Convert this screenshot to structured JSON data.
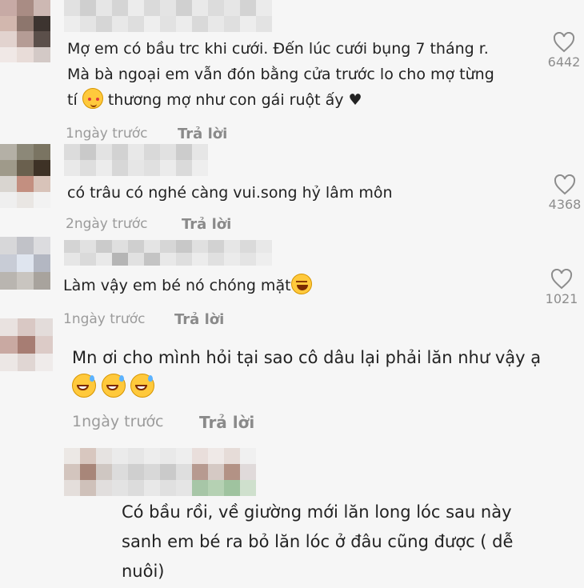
{
  "comments": [
    {
      "lines": [
        "Mợ em có bầu trc khi cưới. Đến lúc cưới bụng 7 tháng r.",
        "Mà bà ngoại em vẫn đón bằng cửa trước lo cho mợ từng",
        "tí"
      ],
      "line3_after_emoji": " thương mợ như con gái ruột ấy ♥",
      "emoji": "smiling-face-with-hearts",
      "time": "1ngày trước",
      "reply": "Trả lời",
      "likes": "6442"
    },
    {
      "lines": [
        "có trâu có nghé càng vui.song hỷ lâm môn"
      ],
      "time": "2ngày trước",
      "reply": "Trả lời",
      "likes": "4368"
    },
    {
      "lines": [
        "Làm vậy em bé nó chóng mặt"
      ],
      "emoji": "rolling-on-floor-laughing",
      "time": "1ngày trước",
      "reply": "Trả lời",
      "likes": "1021"
    },
    {
      "lines": [
        "Mn ơi cho mình hỏi tại sao cô dâu lại phải lăn như vậy ạ"
      ],
      "emoji": "grinning-face-with-sweat",
      "time": "1ngày trước",
      "reply": "Trả lời"
    },
    {
      "lines": [
        "Có bầu rồi, về giường mới lăn long lóc sau này",
        "sanh em bé ra bỏ lăn lóc ở đâu cũng được ( dễ",
        "nuôi)"
      ]
    }
  ],
  "colors": {
    "background": "#f6f6f6",
    "text": "#222222",
    "meta": "#9b9b9b",
    "reply": "#8a8a8a",
    "heart_outline": "#8d8d8d"
  },
  "icons": [
    "heart-outline-icon",
    "blurred-avatar",
    "blurred-username"
  ]
}
